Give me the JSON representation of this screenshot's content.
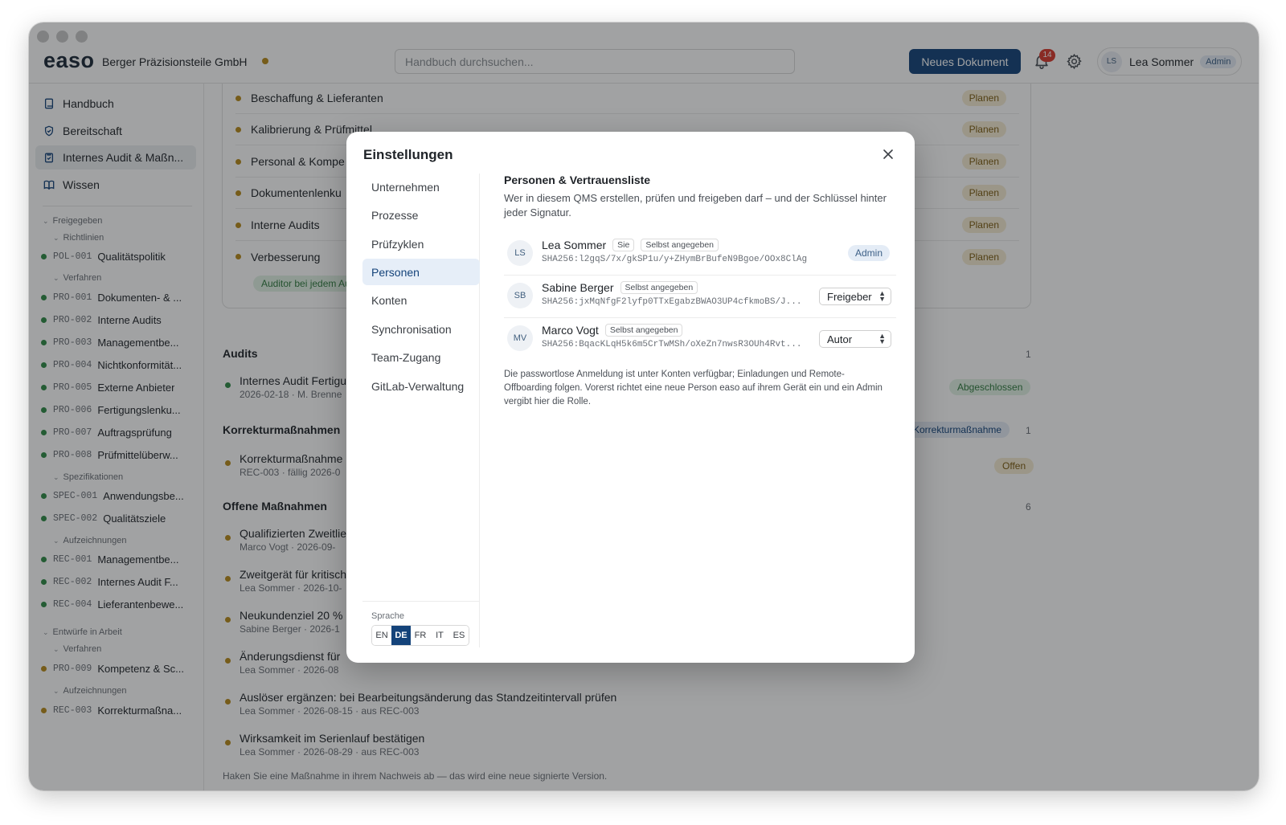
{
  "header": {
    "logo": "easo",
    "company": "Berger Präzisionsteile GmbH",
    "search_placeholder": "Handbuch durchsuchen...",
    "new_document": "Neues Dokument",
    "notification_count": "14",
    "user_initials": "LS",
    "user_name": "Lea Sommer",
    "user_role": "Admin"
  },
  "sidebar": {
    "nav": [
      {
        "label": "Handbuch",
        "icon": "book-icon"
      },
      {
        "label": "Bereitschaft",
        "icon": "shield-check-icon"
      },
      {
        "label": "Internes Audit & Maßn...",
        "icon": "clipboard-icon"
      },
      {
        "label": "Wissen",
        "icon": "open-book-icon"
      }
    ],
    "group_released": "Freigegeben",
    "sub_policies": "Richtlinien",
    "sub_procedures": "Verfahren",
    "sub_specs": "Spezifikationen",
    "sub_records": "Aufzeichnungen",
    "released_policies": [
      {
        "code": "POL-001",
        "title": "Qualitätspolitik"
      }
    ],
    "released_procedures": [
      {
        "code": "PRO-001",
        "title": "Dokumenten- & ..."
      },
      {
        "code": "PRO-002",
        "title": "Interne Audits"
      },
      {
        "code": "PRO-003",
        "title": "Managementbe..."
      },
      {
        "code": "PRO-004",
        "title": "Nichtkonformität..."
      },
      {
        "code": "PRO-005",
        "title": "Externe Anbieter"
      },
      {
        "code": "PRO-006",
        "title": "Fertigungslenku..."
      },
      {
        "code": "PRO-007",
        "title": "Auftragsprüfung"
      },
      {
        "code": "PRO-008",
        "title": "Prüfmittelüberw..."
      }
    ],
    "released_specs": [
      {
        "code": "SPEC-001",
        "title": "Anwendungsbe..."
      },
      {
        "code": "SPEC-002",
        "title": "Qualitätsziele"
      }
    ],
    "released_records": [
      {
        "code": "REC-001",
        "title": "Managementbe..."
      },
      {
        "code": "REC-002",
        "title": "Internes Audit F..."
      },
      {
        "code": "REC-004",
        "title": "Lieferantenbewe..."
      }
    ],
    "group_drafts": "Entwürfe in Arbeit",
    "draft_procedures": [
      {
        "code": "PRO-009",
        "title": "Kompetenz & Sc..."
      }
    ],
    "draft_records": [
      {
        "code": "REC-003",
        "title": "Korrekturmaßna..."
      }
    ]
  },
  "main": {
    "process_rows": [
      {
        "label": "Beschaffung & Lieferanten",
        "status": "Planen"
      },
      {
        "label": "Kalibrierung & Prüfmittel",
        "status": "Planen"
      },
      {
        "label": "Personal & Kompe",
        "status": "Planen"
      },
      {
        "label": "Dokumentenlenku",
        "status": "Planen"
      },
      {
        "label": "Interne Audits",
        "status": "Planen"
      },
      {
        "label": "Verbesserung",
        "status": "Planen"
      }
    ],
    "auditor_pill": "Auditor bei jedem Audi",
    "audits": {
      "title": "Audits",
      "count": "1",
      "entry_title": "Internes Audit Fertigu",
      "entry_sub": "2026-02-18 · M. Brenne",
      "status": "Abgeschlossen"
    },
    "corrective": {
      "title": "Korrekturmaßnahmen",
      "count": "1",
      "pill": "Korrekturmaßnahme",
      "entry_title": "Korrekturmaßnahme",
      "entry_sub": "REC-003 · fällig 2026-0",
      "status": "Offen"
    },
    "open_actions": {
      "title": "Offene Maßnahmen",
      "count": "6",
      "items": [
        {
          "title": "Qualifizierten Zweitlie",
          "sub": "Marco Vogt · 2026-09-"
        },
        {
          "title": "Zweitgerät für kritisch",
          "sub": "Lea Sommer · 2026-10-"
        },
        {
          "title": "Neukundenziel 20 %",
          "sub": "Sabine Berger · 2026-1"
        },
        {
          "title": "Änderungsdienst für",
          "sub": "Lea Sommer · 2026-08"
        },
        {
          "title": "Auslöser ergänzen: bei Bearbeitungsänderung das Standzeitintervall prüfen",
          "sub": "Lea Sommer · 2026-08-15 · aus REC-003"
        },
        {
          "title": "Wirksamkeit im Serienlauf bestätigen",
          "sub": "Lea Sommer · 2026-08-29 · aus REC-003"
        }
      ]
    },
    "footer_note": "Haken Sie eine Maßnahme in ihrem Nachweis ab — das wird eine neue signierte Version."
  },
  "modal": {
    "title": "Einstellungen",
    "nav": [
      "Unternehmen",
      "Prozesse",
      "Prüfzyklen",
      "Personen",
      "Konten",
      "Synchronisation",
      "Team-Zugang",
      "GitLab-Verwaltung"
    ],
    "active_nav": "Personen",
    "language_label": "Sprache",
    "languages": [
      "EN",
      "DE",
      "FR",
      "IT",
      "ES"
    ],
    "active_language": "DE",
    "heading": "Personen & Vertrauensliste",
    "description": "Wer in diesem QMS erstellen, prüfen und freigeben darf – und der Schlüssel hinter jeder Signatur.",
    "people": [
      {
        "initials": "LS",
        "name": "Lea Sommer",
        "you_tag": "Sie",
        "source_tag": "Selbst angegeben",
        "key": "SHA256:l2gqS/7x/gkSP1u/y+ZHymBrBufeN9Bgoe/OOx8ClAg",
        "role": "Admin"
      },
      {
        "initials": "SB",
        "name": "Sabine Berger",
        "source_tag": "Selbst angegeben",
        "key": "SHA256:jxMqNfgF2lyfp0TTxEgabzBWAO3UP4cfkmoBS/J...",
        "role": "Freigeber"
      },
      {
        "initials": "MV",
        "name": "Marco Vogt",
        "source_tag": "Selbst angegeben",
        "key": "SHA256:BqacKLqH5k6m5CrTwMSh/oXeZn7nwsR3OUh4Rvt...",
        "role": "Autor"
      }
    ],
    "note": "Die passwortlose Anmeldung ist unter Konten verfügbar; Einladungen und Remote-Offboarding folgen. Vorerst richtet eine neue Person easo auf ihrem Gerät ein und ein Admin vergibt hier die Rolle."
  },
  "colors": {
    "accent": "#14437a",
    "released_dot": "#2f8a47",
    "draft_dot": "#b88a1c",
    "badge_red": "#d73a2e"
  }
}
